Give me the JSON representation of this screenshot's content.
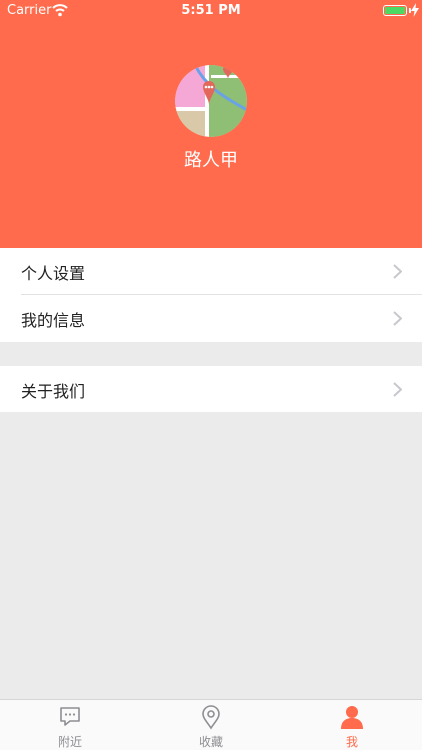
{
  "status_bar": {
    "carrier": "Carrier",
    "time": "5:51 PM",
    "battery_level": 1.0,
    "battery_color": "#4cd964"
  },
  "profile": {
    "name": "路人甲",
    "avatar_icon": "map-pin-avatar-icon",
    "header_color": "#ff6b4c"
  },
  "menu": {
    "group1": [
      {
        "label": "个人设置",
        "icon": "chevron-right-icon"
      },
      {
        "label": "我的信息",
        "icon": "chevron-right-icon"
      }
    ],
    "group2": [
      {
        "label": "关于我们",
        "icon": "chevron-right-icon"
      }
    ]
  },
  "tabbar": {
    "tabs": [
      {
        "label": "附近",
        "icon": "chat-bubble-icon",
        "active": false
      },
      {
        "label": "收藏",
        "icon": "location-pin-icon",
        "active": false
      },
      {
        "label": "我",
        "icon": "person-icon",
        "active": true
      }
    ],
    "active_color": "#ff6b4c",
    "inactive_color": "#8e8e93"
  }
}
